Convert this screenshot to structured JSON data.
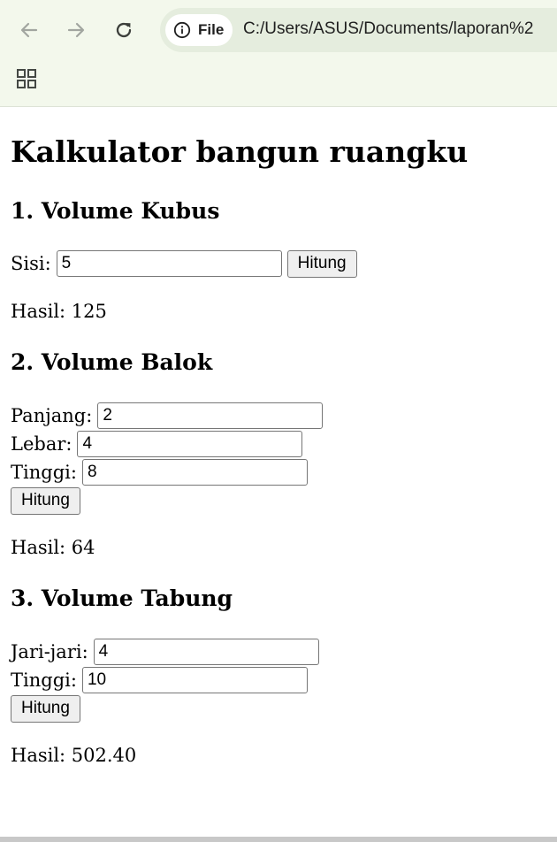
{
  "browser": {
    "icons": [
      "back-arrow-icon",
      "forward-arrow-icon",
      "reload-icon",
      "info-icon",
      "apps-grid-icon"
    ],
    "file_label": "File",
    "url": "C:/Users/ASUS/Documents/laporan%2"
  },
  "page": {
    "title": "Kalkulator bangun ruangku",
    "kubus": {
      "heading": "1. Volume Kubus",
      "sisi_label": "Sisi:",
      "sisi_value": "5",
      "button": "Hitung",
      "result": "Hasil: 125"
    },
    "balok": {
      "heading": "2. Volume Balok",
      "panjang_label": "Panjang:",
      "panjang_value": "2",
      "lebar_label": "Lebar:",
      "lebar_value": "4",
      "tinggi_label": "Tinggi:",
      "tinggi_value": "8",
      "button": "Hitung",
      "result": "Hasil: 64"
    },
    "tabung": {
      "heading": "3. Volume Tabung",
      "jari_label": "Jari-jari:",
      "jari_value": "4",
      "tinggi_label": "Tinggi:",
      "tinggi_value": "10",
      "button": "Hitung",
      "result": "Hasil: 502.40"
    }
  }
}
